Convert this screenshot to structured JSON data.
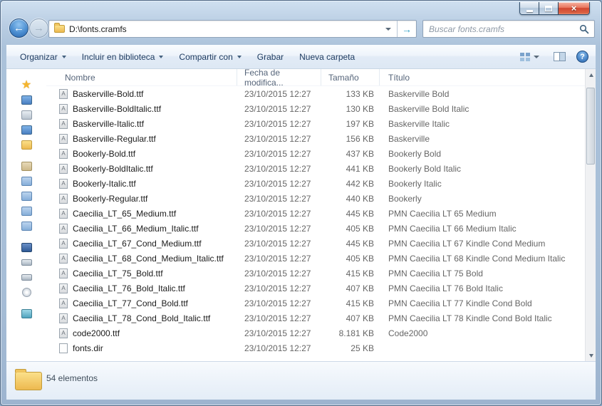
{
  "icons": {
    "back": "←",
    "forward": "→",
    "go": "→",
    "close": "×",
    "help": "?"
  },
  "navbar": {
    "address_path": "D:\\fonts.cramfs",
    "search_placeholder": "Buscar fonts.cramfs"
  },
  "toolbar": {
    "items": [
      {
        "name": "toolbar-organize-button",
        "label": "Organizar",
        "caret": "drop"
      },
      {
        "name": "toolbar-include-in-library-button",
        "label": "Incluir en biblioteca",
        "caret": "drop"
      },
      {
        "name": "toolbar-share-with-button",
        "label": "Compartir con",
        "caret": "drop"
      },
      {
        "name": "toolbar-burn-button",
        "label": "Grabar",
        "caret": ""
      },
      {
        "name": "toolbar-new-folder-button",
        "label": "Nueva carpeta",
        "caret": ""
      }
    ]
  },
  "sidebar": {
    "items": [
      {
        "item": "sidebar-item-favorites",
        "icon": "favorites-star-icon",
        "type": "star"
      },
      {
        "item": "sidebar-item-downloads",
        "icon": "downloads-icon",
        "type": "blue"
      },
      {
        "item": "sidebar-item-desktop",
        "icon": "desktop-icon",
        "type": "gray"
      },
      {
        "item": "sidebar-item-recent-places",
        "icon": "recent-places-icon",
        "type": "blue"
      },
      {
        "item": "sidebar-item-folder",
        "icon": "folder-icon",
        "type": "folder"
      },
      {
        "item": "sidebar-group-spacer",
        "icon": "spacer",
        "type": "gap"
      },
      {
        "item": "sidebar-item-libraries",
        "icon": "libraries-icon",
        "type": "libfolder"
      },
      {
        "item": "sidebar-item-documents",
        "icon": "documents-library-icon",
        "type": "lib"
      },
      {
        "item": "sidebar-item-pictures",
        "icon": "pictures-library-icon",
        "type": "lib"
      },
      {
        "item": "sidebar-item-music",
        "icon": "music-library-icon",
        "type": "lib"
      },
      {
        "item": "sidebar-item-videos",
        "icon": "videos-library-icon",
        "type": "lib"
      },
      {
        "item": "sidebar-group-spacer",
        "icon": "spacer",
        "type": "gap"
      },
      {
        "item": "sidebar-item-computer",
        "icon": "computer-icon",
        "type": "monitor"
      },
      {
        "item": "sidebar-item-local-disk-c",
        "icon": "local-disk-icon",
        "type": "drive"
      },
      {
        "item": "sidebar-item-local-disk-d",
        "icon": "local-disk-icon",
        "type": "drive"
      },
      {
        "item": "sidebar-item-dvd-drive",
        "icon": "dvd-drive-icon",
        "type": "disc"
      },
      {
        "item": "sidebar-group-spacer",
        "icon": "spacer",
        "type": "gap"
      },
      {
        "item": "sidebar-item-network",
        "icon": "network-icon",
        "type": "net"
      }
    ]
  },
  "list": {
    "columns": [
      "Nombre",
      "Fecha de modifica...",
      "Tamaño",
      "Título"
    ],
    "rows": [
      {
        "icon": "ttf-file-icon",
        "icontype": "ttf",
        "name": "Baskerville-Bold.ttf",
        "date": "23/10/2015 12:27",
        "size": "133 KB",
        "title": "Baskerville Bold"
      },
      {
        "icon": "ttf-file-icon",
        "icontype": "ttf",
        "name": "Baskerville-BoldItalic.ttf",
        "date": "23/10/2015 12:27",
        "size": "130 KB",
        "title": "Baskerville Bold Italic"
      },
      {
        "icon": "ttf-file-icon",
        "icontype": "ttf",
        "name": "Baskerville-Italic.ttf",
        "date": "23/10/2015 12:27",
        "size": "197 KB",
        "title": "Baskerville Italic"
      },
      {
        "icon": "ttf-file-icon",
        "icontype": "ttf",
        "name": "Baskerville-Regular.ttf",
        "date": "23/10/2015 12:27",
        "size": "156 KB",
        "title": "Baskerville"
      },
      {
        "icon": "ttf-file-icon",
        "icontype": "ttf",
        "name": "Bookerly-Bold.ttf",
        "date": "23/10/2015 12:27",
        "size": "437 KB",
        "title": "Bookerly Bold"
      },
      {
        "icon": "ttf-file-icon",
        "icontype": "ttf",
        "name": "Bookerly-BoldItalic.ttf",
        "date": "23/10/2015 12:27",
        "size": "441 KB",
        "title": "Bookerly Bold Italic"
      },
      {
        "icon": "ttf-file-icon",
        "icontype": "ttf",
        "name": "Bookerly-Italic.ttf",
        "date": "23/10/2015 12:27",
        "size": "442 KB",
        "title": "Bookerly Italic"
      },
      {
        "icon": "ttf-file-icon",
        "icontype": "ttf",
        "name": "Bookerly-Regular.ttf",
        "date": "23/10/2015 12:27",
        "size": "440 KB",
        "title": "Bookerly"
      },
      {
        "icon": "ttf-file-icon",
        "icontype": "ttf",
        "name": "Caecilia_LT_65_Medium.ttf",
        "date": "23/10/2015 12:27",
        "size": "445 KB",
        "title": "PMN Caecilia LT 65 Medium"
      },
      {
        "icon": "ttf-file-icon",
        "icontype": "ttf",
        "name": "Caecilia_LT_66_Medium_Italic.ttf",
        "date": "23/10/2015 12:27",
        "size": "405 KB",
        "title": "PMN Caecilia LT 66 Medium Italic"
      },
      {
        "icon": "ttf-file-icon",
        "icontype": "ttf",
        "name": "Caecilia_LT_67_Cond_Medium.ttf",
        "date": "23/10/2015 12:27",
        "size": "445 KB",
        "title": "PMN Caecilia LT 67 Kindle Cond Medium"
      },
      {
        "icon": "ttf-file-icon",
        "icontype": "ttf",
        "name": "Caecilia_LT_68_Cond_Medium_Italic.ttf",
        "date": "23/10/2015 12:27",
        "size": "405 KB",
        "title": "PMN Caecilia LT 68 Kindle Cond Medium Italic"
      },
      {
        "icon": "ttf-file-icon",
        "icontype": "ttf",
        "name": "Caecilia_LT_75_Bold.ttf",
        "date": "23/10/2015 12:27",
        "size": "415 KB",
        "title": "PMN Caecilia LT 75 Bold"
      },
      {
        "icon": "ttf-file-icon",
        "icontype": "ttf",
        "name": "Caecilia_LT_76_Bold_Italic.ttf",
        "date": "23/10/2015 12:27",
        "size": "407 KB",
        "title": "PMN Caecilia LT 76 Bold Italic"
      },
      {
        "icon": "ttf-file-icon",
        "icontype": "ttf",
        "name": "Caecilia_LT_77_Cond_Bold.ttf",
        "date": "23/10/2015 12:27",
        "size": "415 KB",
        "title": "PMN Caecilia LT 77 Kindle Cond Bold"
      },
      {
        "icon": "ttf-file-icon",
        "icontype": "ttf",
        "name": "Caecilia_LT_78_Cond_Bold_Italic.ttf",
        "date": "23/10/2015 12:27",
        "size": "407 KB",
        "title": "PMN Caecilia LT 78 Kindle Cond Bold Italic"
      },
      {
        "icon": "ttf-file-icon",
        "icontype": "ttf",
        "name": "code2000.ttf",
        "date": "23/10/2015 12:27",
        "size": "8.181 KB",
        "title": "Code2000"
      },
      {
        "icon": "file-icon",
        "icontype": "plain",
        "name": "fonts.dir",
        "date": "23/10/2015 12:27",
        "size": "25 KB",
        "title": ""
      }
    ]
  },
  "statusbar": {
    "count_text": "54 elementos"
  }
}
